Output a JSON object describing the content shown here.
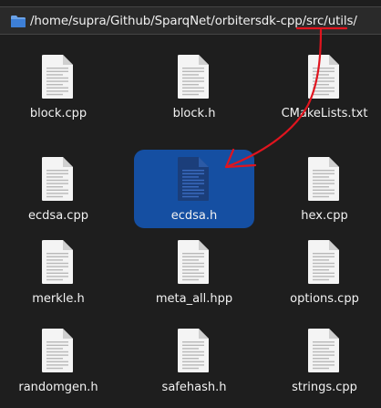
{
  "location": {
    "path_prefix": "/home/supra/Github/SparqNet/orbitersdk-cpp/",
    "path_highlight": "src/utils/",
    "folder_icon": "folder-icon"
  },
  "files": [
    {
      "name": "block.cpp"
    },
    {
      "name": "block.h"
    },
    {
      "name": "CMakeLists.txt"
    },
    {
      "name": "ecdsa.cpp"
    },
    {
      "name": "ecdsa.h",
      "selected": true
    },
    {
      "name": "hex.cpp"
    },
    {
      "name": "merkle.h"
    },
    {
      "name": "meta_all.hpp"
    },
    {
      "name": "options.cpp"
    },
    {
      "name": "randomgen.h"
    },
    {
      "name": "safehash.h"
    },
    {
      "name": "strings.cpp"
    }
  ],
  "colors": {
    "background": "#1e1e1e",
    "selection": "#154fa2",
    "annotation": "#e0141e"
  }
}
